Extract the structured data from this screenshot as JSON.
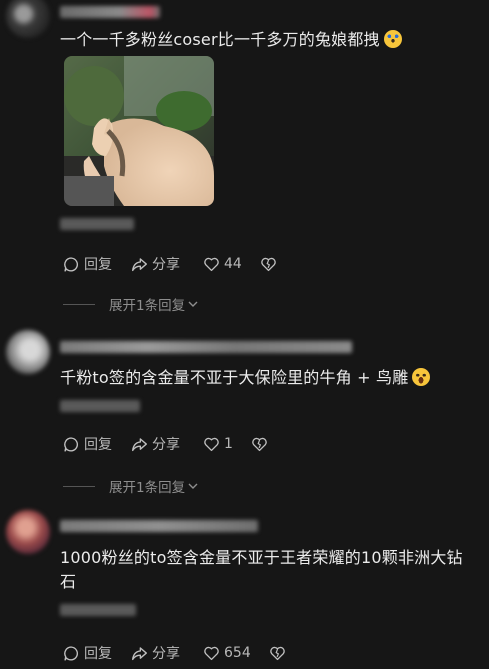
{
  "comments": [
    {
      "text": "一个一千多粉丝coser比一千多万的兔娘都拽",
      "emoji": "rolling-on-floor-laughing-emoji",
      "has_image": true,
      "image_description": "photo-of-dog-covering-face",
      "actions": {
        "reply": "回复",
        "share": "分享",
        "likes": "44"
      },
      "expand_label": "展开1条回复"
    },
    {
      "text": "千粉to签的含金量不亚于大保险里的牛角 + 鸟雕",
      "emoji": "grinning-squinting-emoji",
      "actions": {
        "reply": "回复",
        "share": "分享",
        "likes": "1"
      },
      "expand_label": "展开1条回复"
    },
    {
      "text": "1000粉丝的to签含金量不亚于王者荣耀的10颗非洲大钻石",
      "actions": {
        "reply": "回复",
        "share": "分享",
        "likes": "654"
      }
    }
  ],
  "colors": {
    "background": "#161616",
    "text_primary": "#ebebeb",
    "text_secondary": "#b8b8b8",
    "text_tertiary": "#8e8e8e",
    "emoji_yellow": "#f7c53b"
  }
}
